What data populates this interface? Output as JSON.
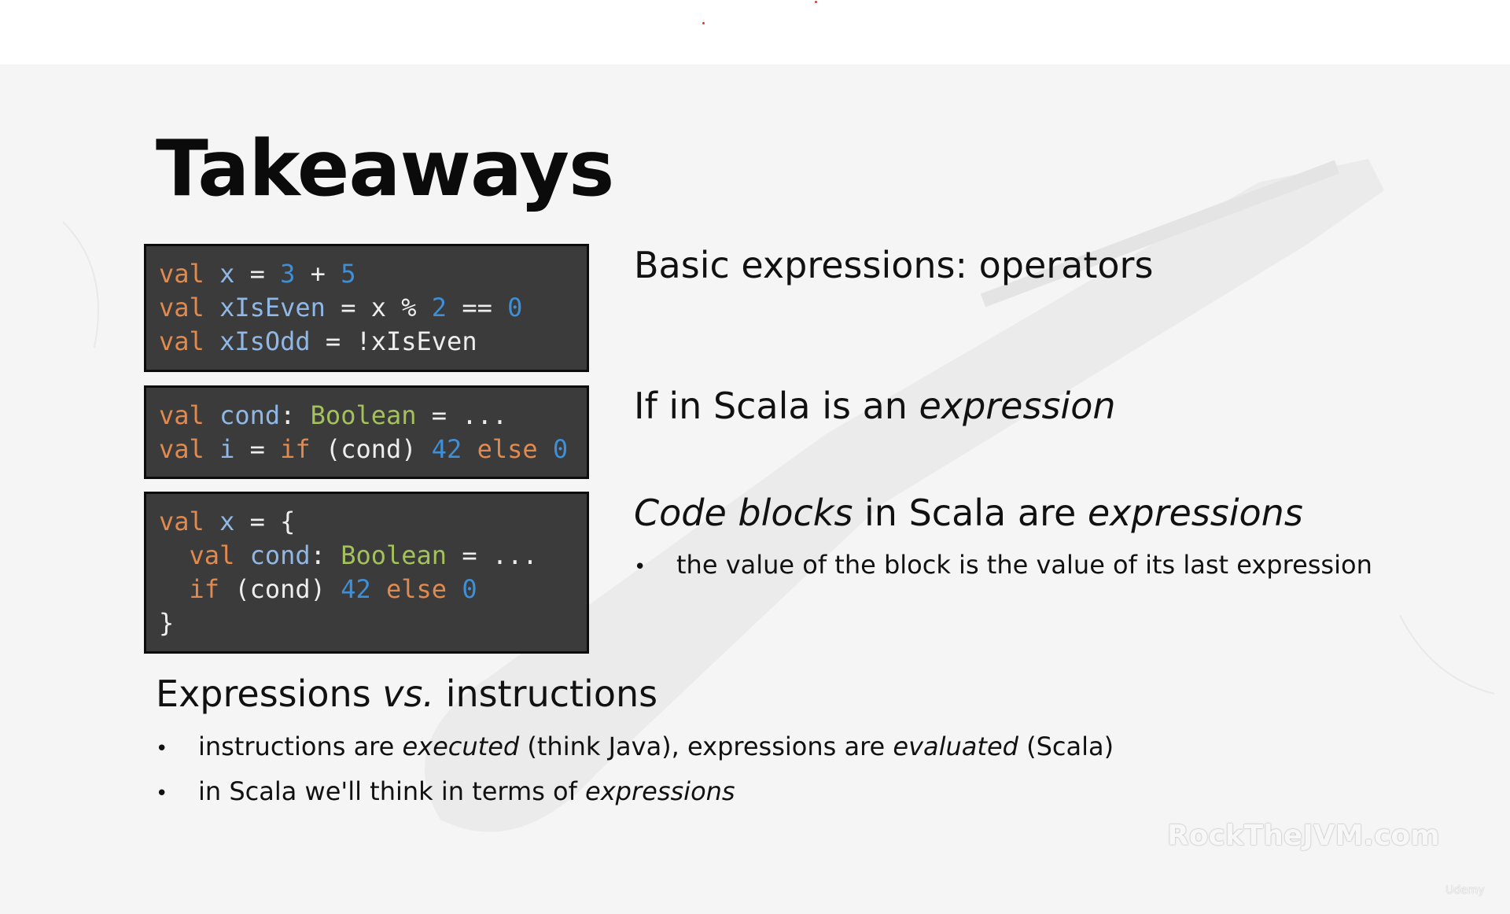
{
  "slide": {
    "title": "Takeaways",
    "code_blocks": [
      {
        "lines": [
          [
            {
              "t": "val ",
              "c": "k"
            },
            {
              "t": "x",
              "c": "v"
            },
            {
              "t": " = ",
              "c": "p"
            },
            {
              "t": "3",
              "c": "n"
            },
            {
              "t": " + ",
              "c": "p"
            },
            {
              "t": "5",
              "c": "n"
            }
          ],
          [
            {
              "t": "val ",
              "c": "k"
            },
            {
              "t": "xIsEven",
              "c": "v"
            },
            {
              "t": " = x % ",
              "c": "p"
            },
            {
              "t": "2",
              "c": "n"
            },
            {
              "t": " == ",
              "c": "p"
            },
            {
              "t": "0",
              "c": "n"
            }
          ],
          [
            {
              "t": "val ",
              "c": "k"
            },
            {
              "t": "xIsOdd",
              "c": "v"
            },
            {
              "t": " = !xIsEven",
              "c": "p"
            }
          ]
        ]
      },
      {
        "lines": [
          [
            {
              "t": "val ",
              "c": "k"
            },
            {
              "t": "cond",
              "c": "v"
            },
            {
              "t": ": ",
              "c": "p"
            },
            {
              "t": "Boolean",
              "c": "t"
            },
            {
              "t": " = ...",
              "c": "p"
            }
          ],
          [
            {
              "t": "val ",
              "c": "k"
            },
            {
              "t": "i",
              "c": "v"
            },
            {
              "t": " = ",
              "c": "p"
            },
            {
              "t": "if",
              "c": "k"
            },
            {
              "t": " (cond) ",
              "c": "p"
            },
            {
              "t": "42",
              "c": "n"
            },
            {
              "t": " else ",
              "c": "k"
            },
            {
              "t": "0",
              "c": "n"
            }
          ]
        ]
      },
      {
        "lines": [
          [
            {
              "t": "val ",
              "c": "k"
            },
            {
              "t": "x",
              "c": "v"
            },
            {
              "t": " = {",
              "c": "p"
            }
          ],
          [
            {
              "t": "  val ",
              "c": "k"
            },
            {
              "t": "cond",
              "c": "v"
            },
            {
              "t": ": ",
              "c": "p"
            },
            {
              "t": "Boolean",
              "c": "t"
            },
            {
              "t": " = ...",
              "c": "p"
            }
          ],
          [
            {
              "t": "  if",
              "c": "k"
            },
            {
              "t": " (cond) ",
              "c": "p"
            },
            {
              "t": "42",
              "c": "n"
            },
            {
              "t": " else ",
              "c": "k"
            },
            {
              "t": "0",
              "c": "n"
            }
          ],
          [
            {
              "t": "}",
              "c": "p"
            }
          ]
        ]
      }
    ],
    "heading1": "Basic expressions: operators",
    "heading2": {
      "a": "If in Scala is an ",
      "b": "expression"
    },
    "heading3": {
      "a": "Code blocks",
      "b": " in Scala are ",
      "c": "expressions"
    },
    "heading3_bullet": "the value of the block is the value of its last expression",
    "heading4": {
      "a": "Expressions ",
      "b": "vs.",
      "c": " instructions"
    },
    "bullet1": {
      "a": "instructions are ",
      "b": "executed",
      "c": " (think Java), expressions are ",
      "d": "evaluated",
      "e": " (Scala)"
    },
    "bullet2": {
      "a": "in Scala we'll think in terms of ",
      "b": "expressions"
    },
    "bullet_marker": "•",
    "watermark": "RockTheJVM.com",
    "udemy_mark": "Udemy"
  }
}
